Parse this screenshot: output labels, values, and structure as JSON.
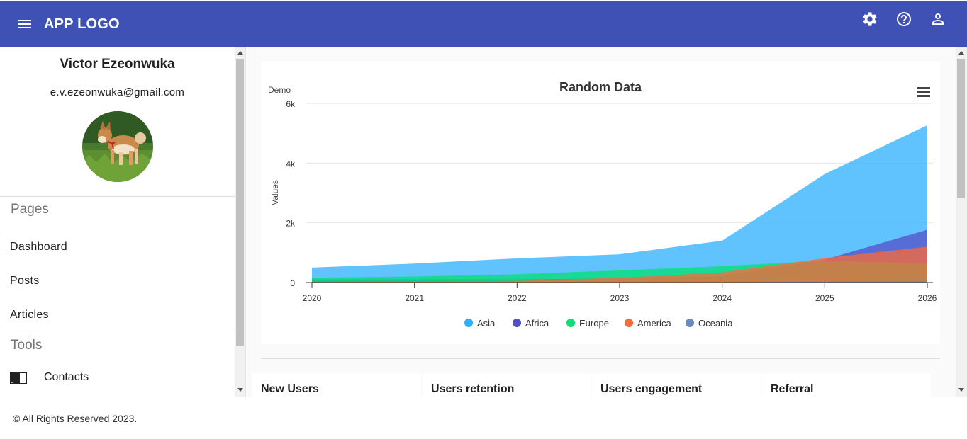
{
  "appbar": {
    "logo": "APP LOGO",
    "color": "#3f51b5",
    "icons": [
      "menu-icon",
      "settings-gear-icon",
      "help-circle-icon",
      "account-user-icon"
    ]
  },
  "profile": {
    "name": "Victor Ezeonwuka",
    "email": "e.v.ezeonwuka@gmail.com"
  },
  "sidebar": {
    "pages_title": "Pages",
    "pages": [
      {
        "label": "Dashboard"
      },
      {
        "label": "Posts"
      },
      {
        "label": "Articles"
      }
    ],
    "tools_title": "Tools",
    "tools": [
      {
        "label": "Contacts",
        "icon": "book-open-icon"
      }
    ]
  },
  "chart_data": {
    "type": "area",
    "title": "Random Data",
    "subtitle": "Demo",
    "xlabel": "",
    "ylabel": "Values",
    "x": [
      "2020",
      "2021",
      "2022",
      "2023",
      "2024",
      "2025",
      "2026"
    ],
    "ylim": [
      0,
      6000
    ],
    "yticks": [
      "0",
      "2k",
      "4k",
      "6k"
    ],
    "grid": true,
    "stacked": false,
    "legend_position": "bottom",
    "series": [
      {
        "name": "Asia",
        "color": "#2caffe",
        "values": [
          502,
          635,
          809,
          947,
          1402,
          3634,
          5268
        ]
      },
      {
        "name": "Africa",
        "color": "#544fc5",
        "values": [
          106,
          107,
          111,
          133,
          221,
          767,
          1766
        ]
      },
      {
        "name": "Europe",
        "color": "#00e272",
        "values": [
          163,
          203,
          276,
          408,
          547,
          729,
          628
        ]
      },
      {
        "name": "America",
        "color": "#fe6a35",
        "values": [
          18,
          31,
          54,
          156,
          339,
          818,
          1201
        ]
      },
      {
        "name": "Oceania",
        "color": "#6b8abc",
        "values": [
          2,
          2,
          2,
          6,
          13,
          30,
          46
        ]
      }
    ]
  },
  "cards": [
    {
      "title": "New Users"
    },
    {
      "title": "Users retention"
    },
    {
      "title": "Users engagement"
    },
    {
      "title": "Referral"
    }
  ],
  "footer": {
    "text": "© All Rights Reserved 2023."
  }
}
